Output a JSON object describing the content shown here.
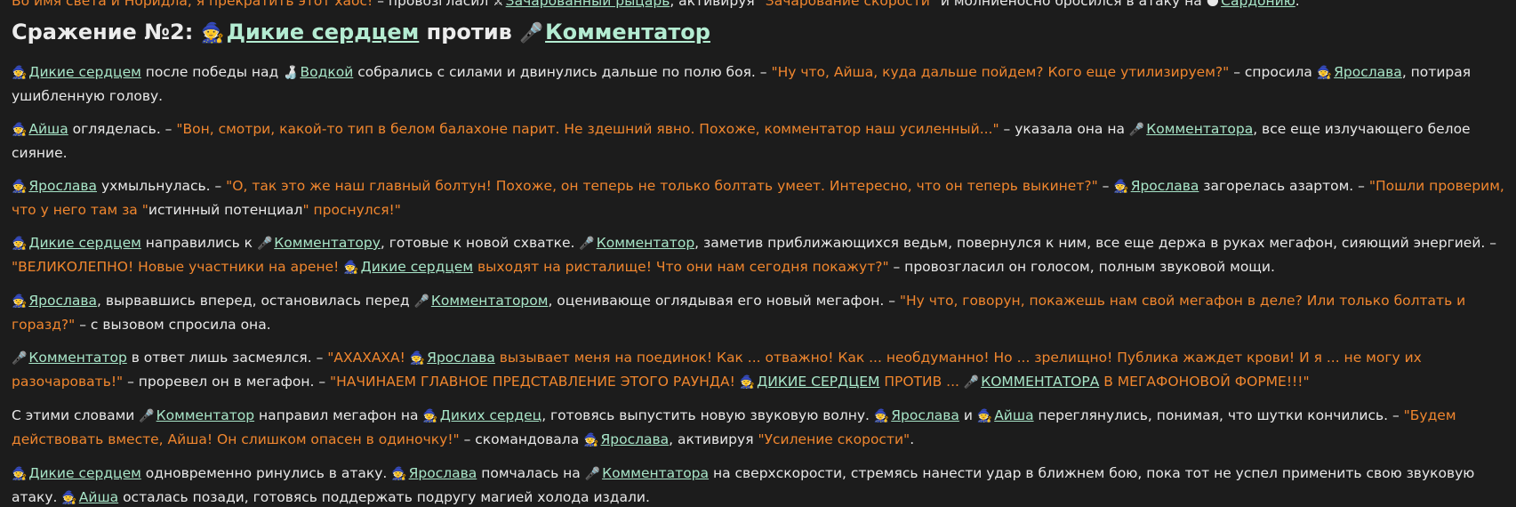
{
  "topline": {
    "t1": "Во имя света и Норидла, я прекратить этот хаос!",
    "t2": " – провозгласил ",
    "l1": "Зачарованный рыцарь",
    "t3": ", активируя ",
    "q1": "\"Зачарование скорости\"",
    "t4": " и молниеносно бросился в атаку на ",
    "l2": "Сардонию",
    "t5": "."
  },
  "heading": {
    "prefix": "Сражение №2: ",
    "team1": "Дикие сердцем",
    "vs": " против ",
    "team2": "Комментатор"
  },
  "icons": {
    "witch": "🧙",
    "mic": "🎤",
    "vodka": "🍶",
    "knight": "⚔",
    "target": "🌑"
  },
  "paragraphs": {
    "p1": {
      "l1": "Дикие сердцем",
      "t1": " после победы над ",
      "l2": "Водкой",
      "t2": " собрались с силами и двинулись дальше по полю боя. – ",
      "q1": "\"Ну что, Айша, куда дальше пойдем? Кого еще утилизируем?\"",
      "t3": " – спросила ",
      "l3": "Ярослава",
      "t4": ", потирая ушибленную голову."
    },
    "p2": {
      "l1": "Айша",
      "t1": " огляделась. – ",
      "q1": "\"Вон, смотри, какой-то тип в белом балахоне парит. Не здешний явно. Похоже, комментатор наш усиленный...\"",
      "t2": " – указала она на ",
      "l2": "Комментатора",
      "t3": ", все еще излучающего белое сияние."
    },
    "p3": {
      "l1": "Ярослава",
      "t1": " ухмыльнулась. – ",
      "q1": "\"О, так это же наш главный болтун! Похоже, он теперь не только болтать умеет. Интересно, что он теперь выкинет?\"",
      "t2": " – ",
      "l2": "Ярослава",
      "t3": " загорелась азартом. – ",
      "q2": "\"Пошли проверим, что у него там за \"",
      "t4": "истинный потенциал",
      "q3": "\" проснулся!\""
    },
    "p4": {
      "l1": "Дикие сердцем",
      "t1": " направились к ",
      "l2": "Комментатору",
      "t2": ", готовые к новой схватке. ",
      "l3": "Комментатор",
      "t3": ", заметив приближающихся ведьм, повернулся к ним, все еще держа в руках мегафон, сияющий энергией. – ",
      "q1": "\"ВЕЛИКОЛЕПНО! Новые участники на арене! ",
      "l4": "Дикие сердцем",
      "q2": " выходят на ристалище! Что они нам сегодня покажут?\"",
      "t4": " – провозгласил он голосом, полным звуковой мощи."
    },
    "p5": {
      "l1": "Ярослава",
      "t1": ", вырвавшись вперед, остановилась перед ",
      "l2": "Комментатором",
      "t2": ", оценивающе оглядывая его новый мегафон. – ",
      "q1": "\"Ну что, говорун, покажешь нам свой мегафон в деле? Или только болтать и горазд?\"",
      "t3": " – с вызовом спросила она."
    },
    "p6": {
      "l1": "Комментатор",
      "t1": " в ответ лишь засмеялся. – ",
      "q1": "\"АХАХАХА! ",
      "l2": "Ярослава",
      "q2": " вызывает меня на поединок! Как ... отважно! Как ... необдуманно! Но ... зрелищно! Публика жаждет крови! И я ... не могу их разочаровать!\"",
      "t2": " – проревел он в мегафон. – ",
      "q3": "\"НАЧИНАЕМ ГЛАВНОЕ ПРЕДСТАВЛЕНИЕ ЭТОГО РАУНДА! ",
      "l3": "ДИКИЕ СЕРДЦЕМ",
      "q4": " ПРОТИВ ... ",
      "l4": "КОММЕНТАТОРА",
      "q5": " В МЕГАФОНОВОЙ ФОРМЕ!!!\""
    },
    "p7": {
      "t1": "С этими словами ",
      "l1": "Комментатор",
      "t2": " направил мегафон на ",
      "l2": "Диких сердец",
      "t3": ", готовясь выпустить новую звуковую волну. ",
      "l3": "Ярослава",
      "t4": " и ",
      "l4": "Айша",
      "t5": " переглянулись, понимая, что шутки кончились. – ",
      "q1": "\"Будем действовать вместе, Айша! Он слишком опасен в одиночку!\"",
      "t6": " – скомандовала ",
      "l5": "Ярослава",
      "t7": ", активируя ",
      "q2": "\"Усиление скорости\"",
      "t8": "."
    },
    "p8": {
      "l1": "Дикие сердцем",
      "t1": " одновременно ринулись в атаку. ",
      "l2": "Ярослава",
      "t2": " помчалась на ",
      "l3": "Комментатора",
      "t3": " на сверхскорости, стремясь нанести удар в ближнем бою, пока тот не успел применить свою звуковую атаку. ",
      "l4": "Айша",
      "t4": " осталась позади, готовясь поддержать подругу магией холода издали."
    }
  }
}
